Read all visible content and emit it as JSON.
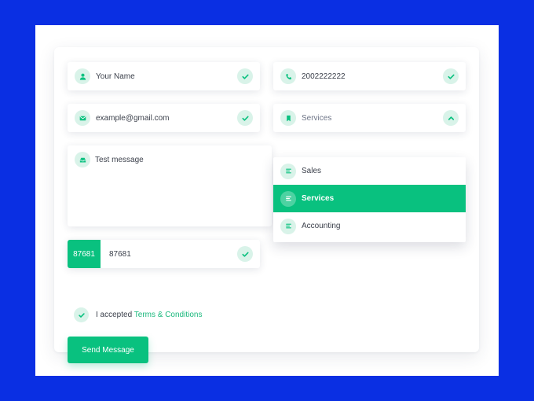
{
  "form": {
    "name": {
      "value": "Your Name",
      "icon": "user-icon"
    },
    "phone": {
      "value": "2002222222",
      "icon": "phone-icon"
    },
    "email": {
      "value": "example@gmail.com",
      "icon": "mail-icon"
    },
    "service": {
      "placeholder": "Services",
      "icon": "bookmark-icon"
    },
    "message": {
      "value": "Test message",
      "icon": "inbox-icon"
    },
    "captcha": {
      "code": "87681",
      "value": "87681"
    },
    "terms": {
      "prefix": "I accepted",
      "link": "Terms & Conditions",
      "checked": true
    },
    "submit_label": "Send Message"
  },
  "dropdown": {
    "options": [
      {
        "label": "Sales",
        "selected": false,
        "icon": "list-icon"
      },
      {
        "label": "Services",
        "selected": true,
        "icon": "list-icon"
      },
      {
        "label": "Accounting",
        "selected": false,
        "icon": "list-icon"
      }
    ]
  },
  "colors": {
    "background": "#0a2fe3",
    "accent": "#09c17f",
    "icon_bg": "#d9f3e9",
    "link": "#19b87c"
  }
}
